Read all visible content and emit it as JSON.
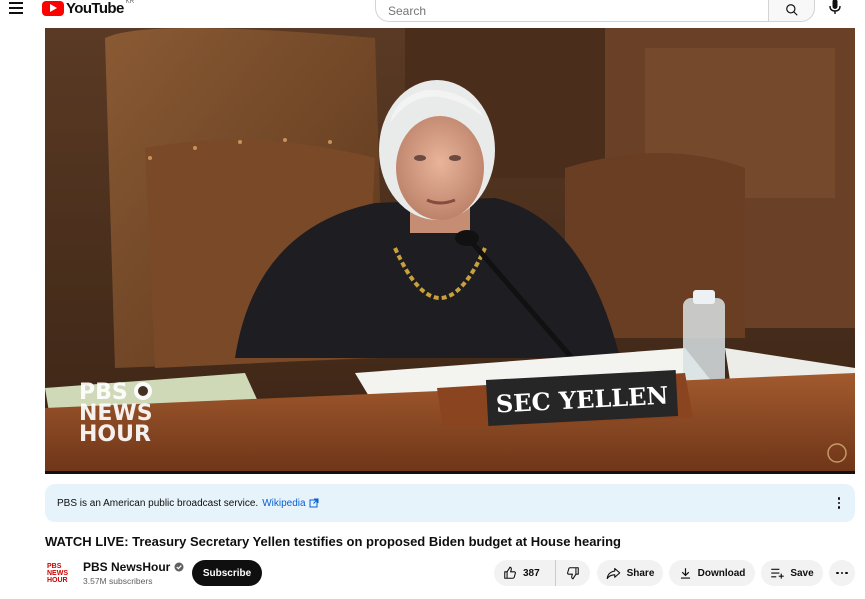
{
  "header": {
    "logo_text": "YouTube",
    "logo_country": "KR",
    "search_placeholder": "Search"
  },
  "video": {
    "nameplate": "SEC YELLEN",
    "watermark_lines": [
      "PBS",
      "NEWS",
      "HOUR"
    ]
  },
  "banner": {
    "text": "PBS is an American public broadcast service.",
    "link": "Wikipedia"
  },
  "title": "WATCH LIVE: Treasury Secretary Yellen testifies on proposed Biden budget at House hearing",
  "channel": {
    "logo_lines": [
      "PBS",
      "NEWS",
      "HOUR"
    ],
    "name": "PBS NewsHour",
    "subscribers": "3.57M subscribers",
    "subscribe_label": "Subscribe"
  },
  "actions": {
    "likes": "387",
    "share_label": "Share",
    "download_label": "Download",
    "save_label": "Save"
  },
  "colors": {
    "brand_red": "#ff0000",
    "subscribe_bg": "#0f0f0f",
    "link_blue": "#065fd4",
    "banner_bg": "#e7f3fb"
  }
}
